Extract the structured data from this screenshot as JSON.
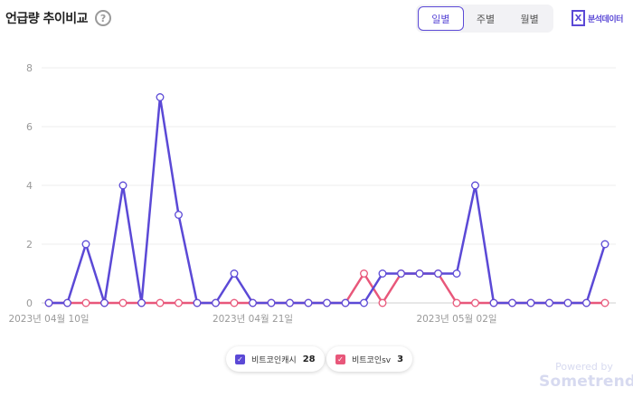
{
  "header": {
    "title": "언급량 추이비교",
    "help_glyph": "?",
    "period_tabs": [
      {
        "label": "일별",
        "active": true
      },
      {
        "label": "주별",
        "active": false
      },
      {
        "label": "월별",
        "active": false
      }
    ],
    "brand_glyph": "X",
    "brand_label": "분석데이터"
  },
  "legend": [
    {
      "name": "비트코인캐시",
      "count": "28",
      "color": "#5b49d6"
    },
    {
      "name": "비트코인sv",
      "count": "3",
      "color": "#e8577a"
    }
  ],
  "watermark": {
    "line1": "Powered by",
    "line2": "Sometrend"
  },
  "chart_data": {
    "type": "line",
    "ylim": [
      0,
      8
    ],
    "yticks": [
      "0",
      "2",
      "4",
      "6",
      "8"
    ],
    "grid": true,
    "x_tick_labels": [
      {
        "index": 0,
        "label": "2023년 04월 10일"
      },
      {
        "index": 11,
        "label": "2023년 04월 21일"
      },
      {
        "index": 22,
        "label": "2023년 05월 02일"
      }
    ],
    "series": [
      {
        "name": "비트코인캐시",
        "color": "#5b49d6",
        "values": [
          0,
          0,
          2,
          0,
          4,
          0,
          7,
          3,
          0,
          0,
          1,
          0,
          0,
          0,
          0,
          0,
          0,
          0,
          1,
          1,
          1,
          1,
          1,
          4,
          0,
          0,
          0,
          0,
          0,
          0,
          2
        ]
      },
      {
        "name": "비트코인sv",
        "color": "#e8577a",
        "values": [
          0,
          0,
          0,
          0,
          0,
          0,
          0,
          0,
          0,
          0,
          0,
          0,
          0,
          0,
          0,
          0,
          0,
          1,
          0,
          1,
          1,
          1,
          0,
          0,
          0,
          0,
          0,
          0,
          0,
          0,
          0
        ]
      }
    ]
  }
}
